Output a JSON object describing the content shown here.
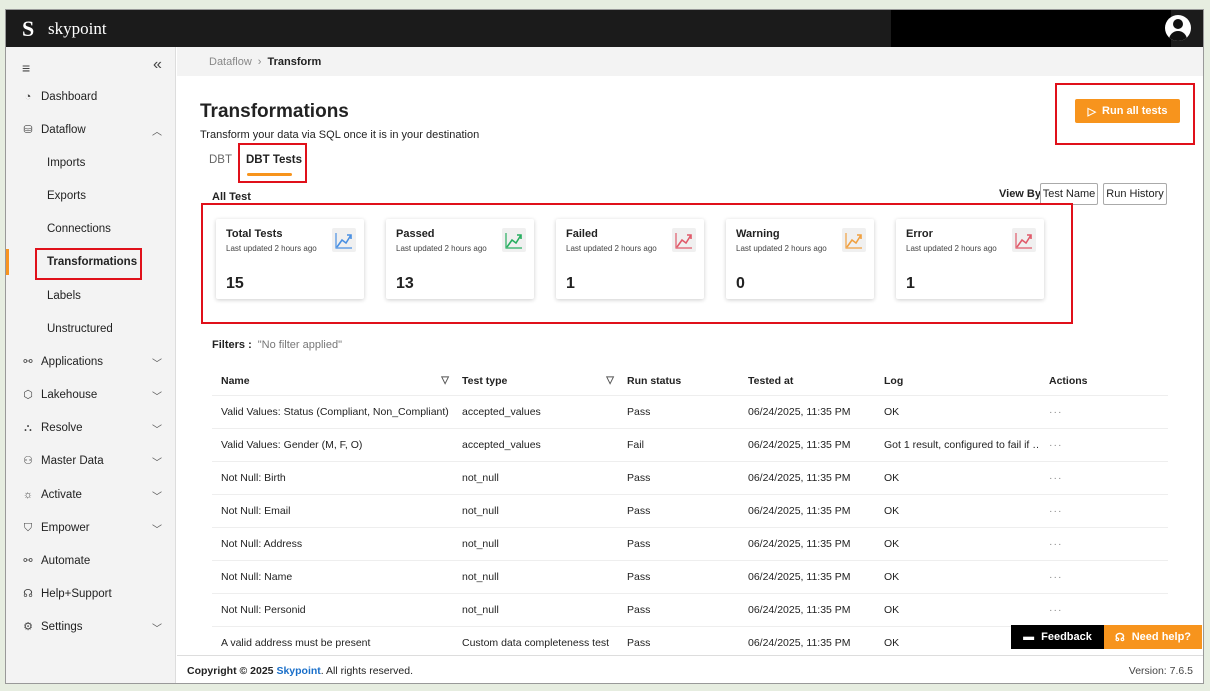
{
  "app": {
    "logo_letter": "S",
    "brand": "skypoint"
  },
  "colors": {
    "accent": "#f7941d",
    "annotation": "#e0101a",
    "total": "#4a90e2",
    "passed": "#27ae60",
    "failed": "#e05a6a",
    "warning": "#f0a040",
    "error": "#e05a6a"
  },
  "sidebar": {
    "items": [
      {
        "label": "Dashboard",
        "icon": "gauge-icon"
      },
      {
        "label": "Dataflow",
        "icon": "database-icon",
        "chevron": "up"
      },
      {
        "label": "Imports"
      },
      {
        "label": "Exports"
      },
      {
        "label": "Connections"
      },
      {
        "label": "Transformations",
        "active": true
      },
      {
        "label": "Labels"
      },
      {
        "label": "Unstructured"
      },
      {
        "label": "Applications",
        "icon": "link-icon",
        "chevron": "down"
      },
      {
        "label": "Lakehouse",
        "icon": "cube-icon",
        "chevron": "down"
      },
      {
        "label": "Resolve",
        "icon": "hierarchy-icon",
        "chevron": "down"
      },
      {
        "label": "Master Data",
        "icon": "people-icon",
        "chevron": "down"
      },
      {
        "label": "Activate",
        "icon": "bulb-icon",
        "chevron": "down"
      },
      {
        "label": "Empower",
        "icon": "shield-icon",
        "chevron": "down"
      },
      {
        "label": "Automate",
        "icon": "flow-icon"
      },
      {
        "label": "Help+Support",
        "icon": "headset-icon"
      },
      {
        "label": "Settings",
        "icon": "gear-icon",
        "chevron": "down"
      }
    ]
  },
  "breadcrumb": {
    "parent": "Dataflow",
    "current": "Transform"
  },
  "page": {
    "title": "Transformations",
    "subtitle": "Transform your data via SQL once it is in your destination",
    "run_all": "Run all tests"
  },
  "tabs": [
    {
      "label": "DBT"
    },
    {
      "label": "DBT Tests",
      "active": true
    }
  ],
  "section": {
    "title": "All Test",
    "view_by": "View By:",
    "view_options": [
      "Test Name",
      "Run History"
    ]
  },
  "cards": [
    {
      "title": "Total Tests",
      "updated": "Last updated 2 hours ago",
      "value": "15"
    },
    {
      "title": "Passed",
      "updated": "Last updated 2 hours ago",
      "value": "13"
    },
    {
      "title": "Failed",
      "updated": "Last updated 2 hours ago",
      "value": "1"
    },
    {
      "title": "Warning",
      "updated": "Last updated 2 hours ago",
      "value": "0"
    },
    {
      "title": "Error",
      "updated": "Last updated 2 hours ago",
      "value": "1"
    }
  ],
  "filters": {
    "label": "Filters :",
    "value": "\"No filter applied\""
  },
  "table": {
    "headers": [
      "Name",
      "Test type",
      "Run status",
      "Tested at",
      "Log",
      "Actions"
    ],
    "rows": [
      [
        "Valid Values: Status (Compliant, Non_Compliant)",
        "accepted_values",
        "Pass",
        "06/24/2025, 11:35 PM",
        "OK",
        "···"
      ],
      [
        "Valid Values: Gender (M, F, O)",
        "accepted_values",
        "Fail",
        "06/24/2025, 11:35 PM",
        "Got 1 result, configured to fail if …",
        "···"
      ],
      [
        "Not Null: Birth",
        "not_null",
        "Pass",
        "06/24/2025, 11:35 PM",
        "OK",
        "···"
      ],
      [
        "Not Null: Email",
        "not_null",
        "Pass",
        "06/24/2025, 11:35 PM",
        "OK",
        "···"
      ],
      [
        "Not Null: Address",
        "not_null",
        "Pass",
        "06/24/2025, 11:35 PM",
        "OK",
        "···"
      ],
      [
        "Not Null: Name",
        "not_null",
        "Pass",
        "06/24/2025, 11:35 PM",
        "OK",
        "···"
      ],
      [
        "Not Null: Personid",
        "not_null",
        "Pass",
        "06/24/2025, 11:35 PM",
        "OK",
        "···"
      ],
      [
        "A valid address must be present",
        "Custom data completeness test",
        "Pass",
        "06/24/2025, 11:35 PM",
        "OK",
        ""
      ]
    ]
  },
  "footer": {
    "copyright": "Copyright © 2025",
    "company": "Skypoint",
    "rights": ". All rights reserved.",
    "version": "Version: 7.6.5"
  },
  "floating": {
    "feedback": "Feedback",
    "help": "Need help?"
  }
}
